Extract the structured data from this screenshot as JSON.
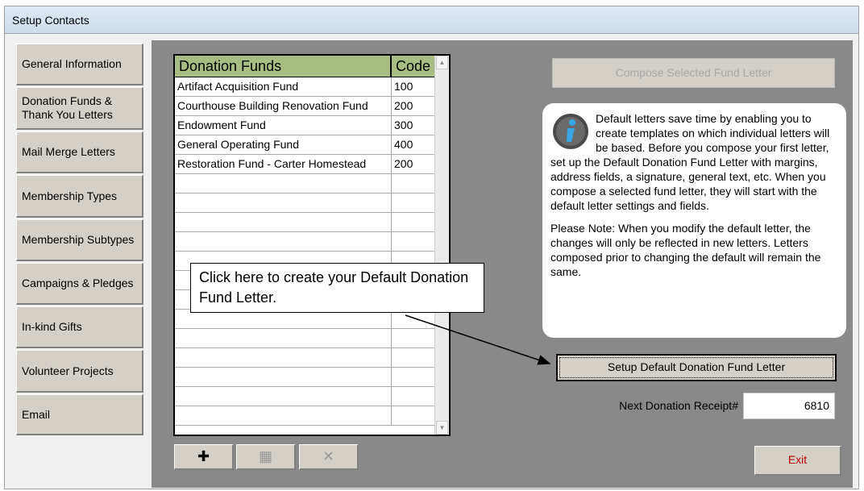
{
  "window": {
    "title": "Setup Contacts"
  },
  "nav": [
    {
      "label": "General Information"
    },
    {
      "label": "Donation Funds & Thank You Letters"
    },
    {
      "label": "Mail Merge Letters"
    },
    {
      "label": "Membership Types"
    },
    {
      "label": "Membership Subtypes"
    },
    {
      "label": "Campaigns & Pledges"
    },
    {
      "label": "In-kind Gifts"
    },
    {
      "label": "Volunteer Projects"
    },
    {
      "label": "Email"
    }
  ],
  "funds_table": {
    "headers": {
      "name": "Donation Funds",
      "code": "Code"
    },
    "rows": [
      {
        "name": "Artifact Acquisition Fund",
        "code": "100"
      },
      {
        "name": "Courthouse Building Renovation Fund",
        "code": "200"
      },
      {
        "name": "Endowment Fund",
        "code": "300"
      },
      {
        "name": "General Operating Fund",
        "code": "400"
      },
      {
        "name": "Restoration Fund - Carter Homestead",
        "code": "200"
      }
    ]
  },
  "toolbar": {
    "add_icon": "plus-icon",
    "edit_icon": "edit-document-icon",
    "delete_icon": "x-icon"
  },
  "compose_button": "Compose Selected Fund Letter",
  "info": {
    "icon": "info-icon",
    "paragraph1": "Default letters save time by enabling you to create templates on which individual letters will be based. Before you compose your first letter, set up the Default Donation Fund Letter with margins, address fields, a signature, general text, etc. When you compose a selected fund letter, they will start with the default letter settings and fields.",
    "paragraph2": "Please Note:  When you modify the default letter, the changes will only be reflected in new letters. Letters composed prior to changing the default will remain the same."
  },
  "setup_button": "Setup Default Donation Fund Letter",
  "receipt": {
    "label": "Next Donation Receipt#",
    "value": "6810"
  },
  "exit_button": "Exit",
  "callout": {
    "text": "Click here to create your Default Donation Fund Letter."
  }
}
